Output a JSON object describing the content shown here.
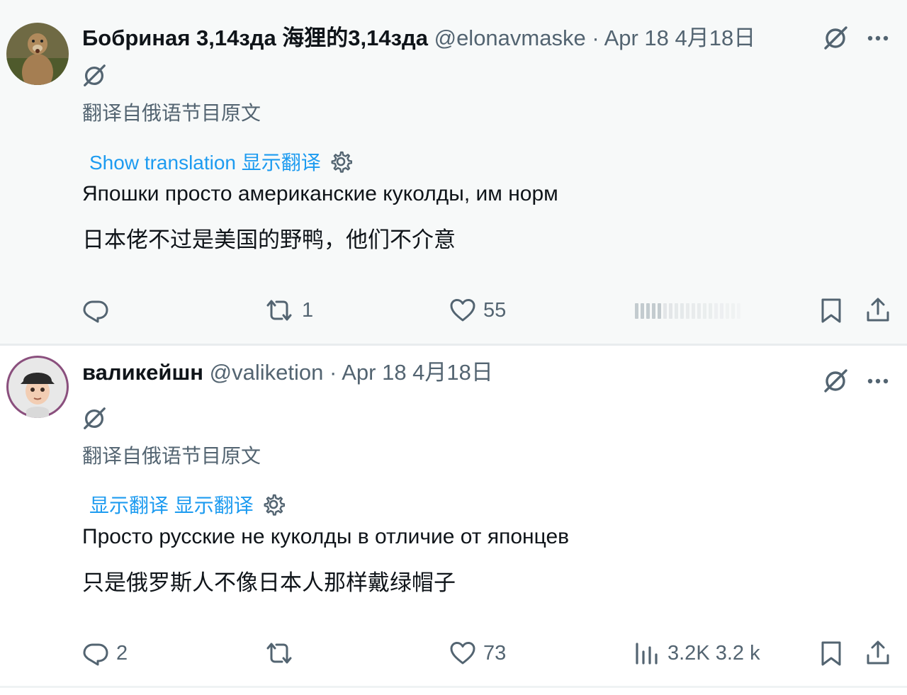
{
  "tweets": [
    {
      "name": "Бобриная 3,14зда 海狸的3,14зда",
      "handle": "@elonavmaske",
      "separator": "·",
      "date": "Apr 18 4月18日",
      "translated_note": "翻译自俄语节目原文",
      "show_translation": "Show translation 显示翻译",
      "text_original": "Япошки просто американские куколды, им норм",
      "text_translated": "日本佬不过是美国的野鸭，他们不介意",
      "replies": "",
      "reposts": "1",
      "likes": "55",
      "views": ""
    },
    {
      "name": "валикейшн",
      "handle": "@valiketion",
      "separator": "·",
      "date": "Apr 18 4月18日",
      "translated_note": "翻译自俄语节目原文",
      "show_translation": "显示翻译 显示翻译",
      "text_original": "Просто русские не куколды в отличие от японцев",
      "text_translated": "只是俄罗斯人不像日本人那样戴绿帽子",
      "replies": "2",
      "reposts": "",
      "likes": "73",
      "views": "3.2K 3.2 k"
    }
  ],
  "icons": {
    "grok": "grok-icon",
    "more": "more-icon",
    "reply": "reply-icon",
    "repost": "repost-icon",
    "like": "heart-icon",
    "views": "views-icon",
    "bookmark": "bookmark-icon",
    "share": "share-icon",
    "settings": "gear-icon"
  },
  "colors": {
    "link": "#1d9bf0",
    "secondary": "#536471",
    "text": "#0f1419"
  }
}
